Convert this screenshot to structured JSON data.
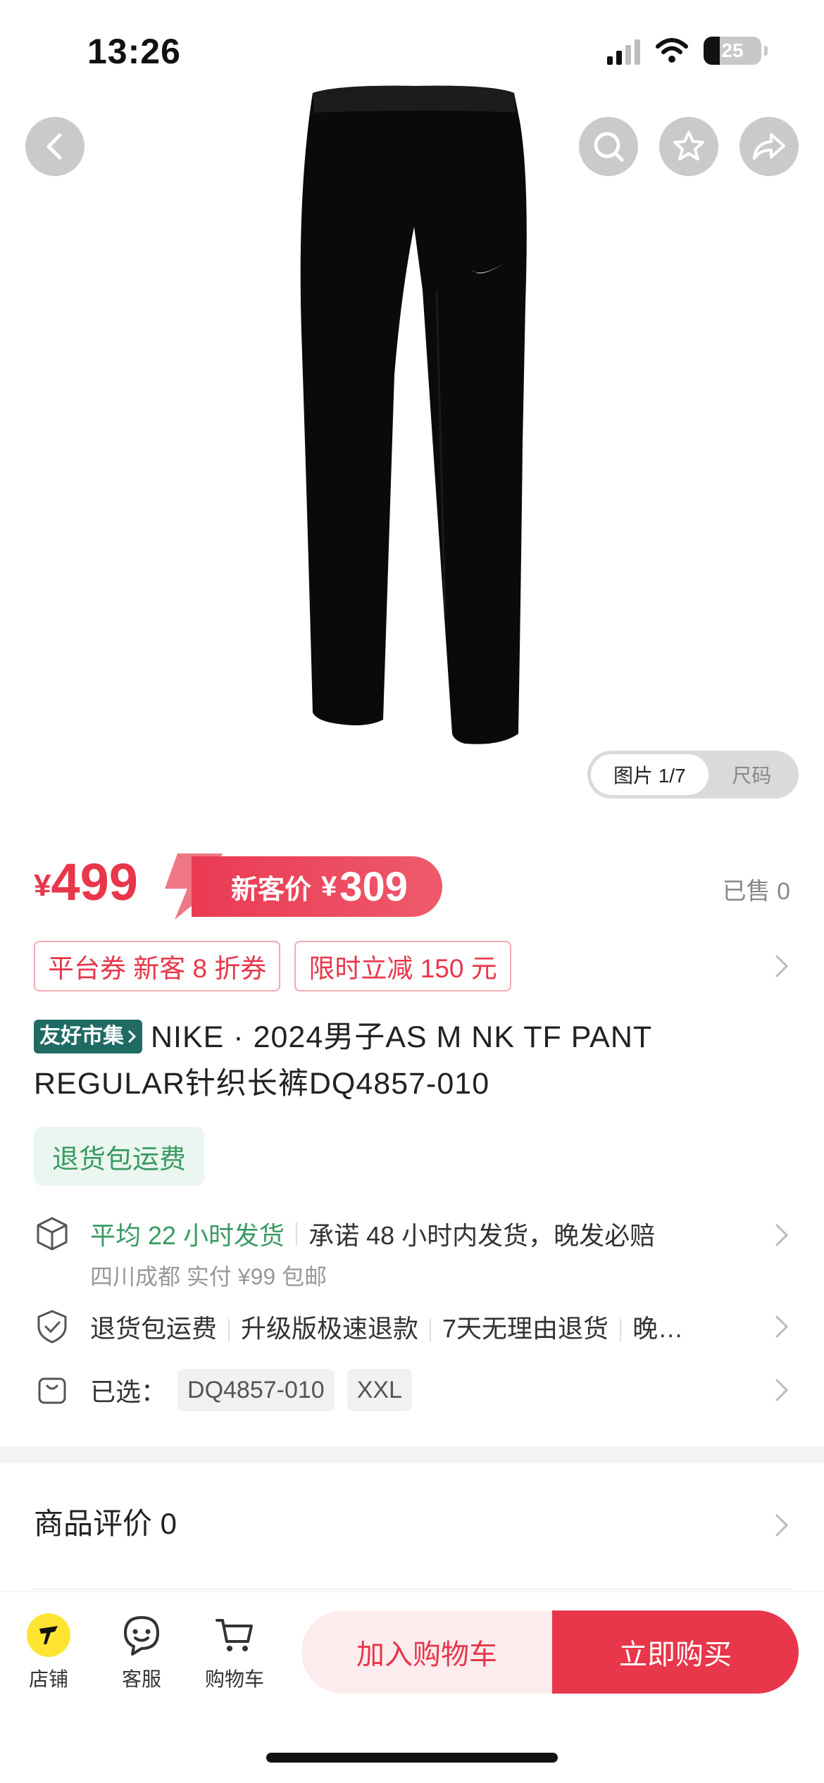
{
  "status_bar": {
    "time": "13:26",
    "battery": "25"
  },
  "gallery": {
    "tabs": [
      {
        "label": "图片 1/7",
        "active": true
      },
      {
        "label": "尺码",
        "active": false
      }
    ]
  },
  "price": {
    "currency": "¥",
    "original": "499",
    "new_customer_label": "新客价",
    "new_customer_price": "309",
    "sold": "已售 0"
  },
  "coupons": [
    "平台券 新客 8 折券",
    "限时立减 150 元"
  ],
  "product": {
    "badge": "友好市集",
    "title": "NIKE · 2024男子AS M NK TF PANT REGULAR针织长裤DQ4857-010"
  },
  "free_return_tag": "退货包运费",
  "shipping": {
    "highlight": "平均 22 小时发货",
    "promise": "承诺 48 小时内发货，晚发必赔",
    "sub": "四川成都 实付 ¥99 包邮"
  },
  "guarantees": [
    "退货包运费",
    "升级版极速退款",
    "7天无理由退货",
    "晚…"
  ],
  "selection": {
    "label": "已选：",
    "options": [
      "DQ4857-010",
      "XXL"
    ]
  },
  "reviews": {
    "label": "商品评价 0"
  },
  "bottom_bar": {
    "store": "店铺",
    "service": "客服",
    "cart": "购物车",
    "add_to_cart": "加入购物车",
    "buy_now": "立即购买"
  },
  "colors": {
    "accent": "#e8364b",
    "green": "#3a9a62",
    "badge": "#1f6b64"
  }
}
